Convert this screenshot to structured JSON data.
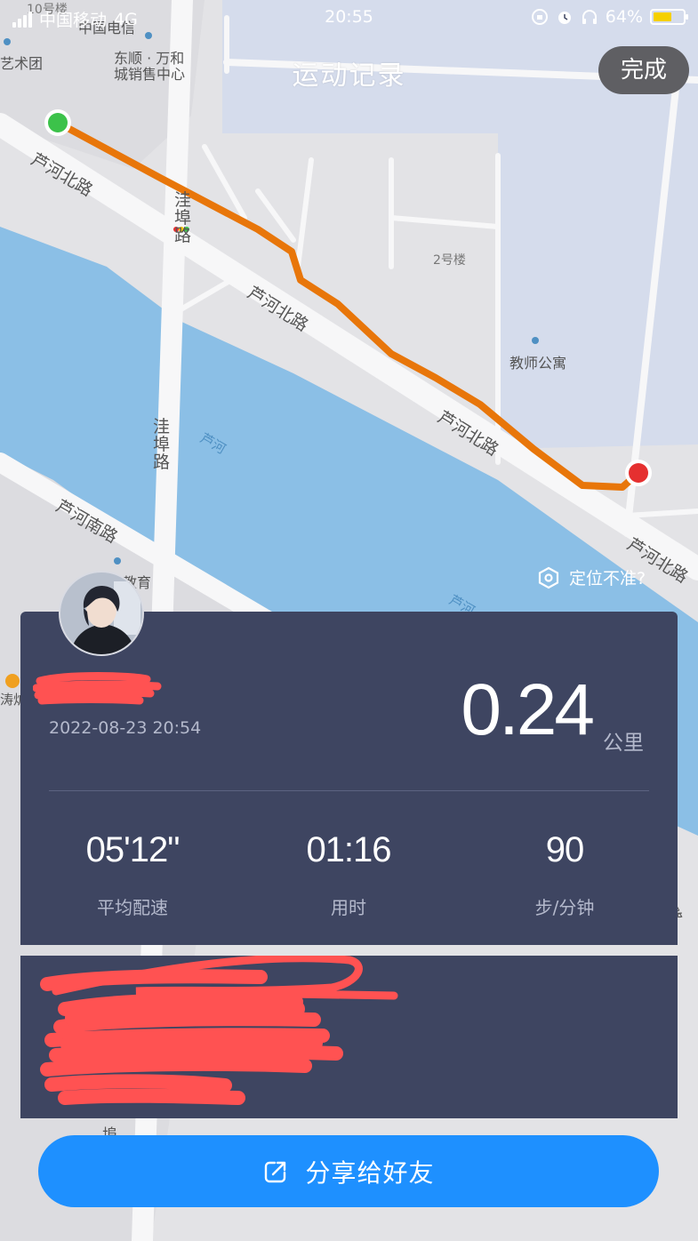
{
  "status_bar": {
    "carrier": "中国移动",
    "network": "4G",
    "time": "20:55",
    "battery_percent": "64%",
    "battery_level": 0.64,
    "battery_color": "#f5d000"
  },
  "header": {
    "title": "运动记录",
    "done_label": "完成"
  },
  "map": {
    "labels": {
      "building_10": "10号楼",
      "art_troupe": "艺术团",
      "telecom": "中国电信",
      "sales_center_1": "东顺 · 万和",
      "sales_center_2": "城销售中心",
      "luhe_north_1": "芦河北路",
      "luhe_north_2": "芦河北路",
      "luhe_north_3": "芦河北路",
      "luhe_north_4": "芦河北路",
      "wabu_1": "洼埠路",
      "wabu_2": "洼埠路",
      "building_2": "2号楼",
      "teacher_apartment": "教师公寓",
      "luhe_river_1": "芦河",
      "luhe_river_2": "芦河",
      "luhe_south": "芦河南路",
      "education": "教育",
      "tao_partial": "涛炉",
      "road_partial": "南路",
      "wabu_bottom": "埠"
    },
    "start_color": "#3cc24a",
    "end_color": "#e53030",
    "route_color": "#e8760a",
    "water_color": "#8bbfe6"
  },
  "locate_tip": "定位不准?",
  "summary": {
    "date": "2022-08-23 20:54",
    "distance": "0.24",
    "distance_unit": "公里",
    "stats": [
      {
        "value": "05'12\"",
        "label": "平均配速"
      },
      {
        "value": "01:16",
        "label": "用时"
      },
      {
        "value": "90",
        "label": "步/分钟"
      }
    ]
  },
  "share_label": "分享给好友",
  "colors": {
    "card_bg": "#3e4561",
    "share_bg": "#1e90ff",
    "redaction": "#ff5252"
  }
}
